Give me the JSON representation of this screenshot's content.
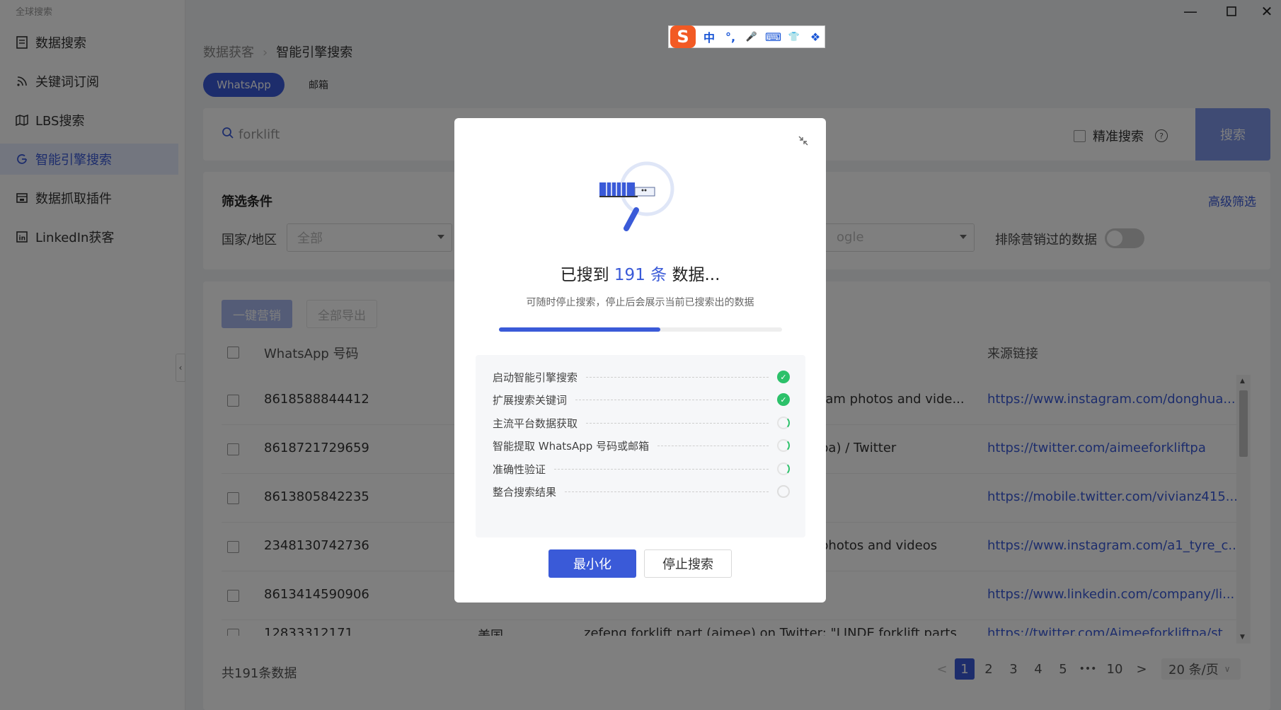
{
  "app_title": "全球搜索",
  "sidebar": {
    "items": [
      {
        "label": "数据搜索",
        "icon": "document-icon",
        "active": false
      },
      {
        "label": "关键词订阅",
        "icon": "rss-icon",
        "active": false
      },
      {
        "label": "LBS搜索",
        "icon": "map-icon",
        "active": false
      },
      {
        "label": "智能引擎搜索",
        "icon": "google-g-icon",
        "active": true
      },
      {
        "label": "数据抓取插件",
        "icon": "plugin-icon",
        "active": false
      },
      {
        "label": "LinkedIn获客",
        "icon": "linkedin-icon",
        "active": false
      }
    ]
  },
  "breadcrumb": {
    "parent": "数据获客",
    "current": "智能引擎搜索"
  },
  "tabs": {
    "active": "WhatsApp",
    "other": "邮箱"
  },
  "search": {
    "value": "forklift",
    "exact_label": "精准搜索",
    "help": "?",
    "button": "搜索"
  },
  "filters": {
    "title": "筛选条件",
    "advanced": "高级筛选",
    "country_label": "国家/地区",
    "country_value": "全部",
    "engine_value": "Google",
    "engine_visible_fragment": "ogle",
    "exclude_label": "排除营销过的数据"
  },
  "table": {
    "actions": {
      "market": "一键营销",
      "export": "全部导出"
    },
    "headers": {
      "phone": "WhatsApp 号码",
      "source": "来源链接"
    },
    "rows": [
      {
        "phone": "8618588844412",
        "country": "",
        "title": "ram photos and vide...",
        "link": "https://www.instagram.com/donghua..."
      },
      {
        "phone": "8618721729659",
        "country": "",
        "title": "pa) / Twitter",
        "link": "https://twitter.com/aimeeforkliftpa"
      },
      {
        "phone": "8613805842235",
        "country": "",
        "title": "",
        "link": "https://mobile.twitter.com/vivianz415..."
      },
      {
        "phone": "2348130742736",
        "country": "",
        "title": "photos and videos",
        "link": "https://www.instagram.com/a1_tyre_c..."
      },
      {
        "phone": "8613414590906",
        "country": "",
        "title": "",
        "link": "https://www.linkedin.com/company/li..."
      },
      {
        "phone": "12833312171",
        "country": "美国",
        "title": "zefeng forklift part (aimee) on Twitter: \"LINDE forklift parts",
        "link": "https://twitter.com/Aimeeforkliftpa/st"
      }
    ],
    "total": "共191条数据",
    "pagination": {
      "prev": "<",
      "pages": [
        "1",
        "2",
        "3",
        "4",
        "5"
      ],
      "ellipsis": "•••",
      "last": "10",
      "next": ">",
      "page_size": "20 条/页",
      "current": 1
    }
  },
  "ime": {
    "logo": "S",
    "items": [
      "中",
      "°,",
      "🎤",
      "⌨",
      "👕",
      "❖"
    ]
  },
  "modal": {
    "headline_prefix": "已搜到 ",
    "count": "191 条",
    "headline_suffix": " 数据...",
    "subtitle": "可随时停止搜索，停止后会展示当前已搜索出的数据",
    "progress": 0.57,
    "steps": [
      {
        "label": "启动智能引擎搜索",
        "status": "done"
      },
      {
        "label": "扩展搜索关键词",
        "status": "done"
      },
      {
        "label": "主流平台数据获取",
        "status": "loading"
      },
      {
        "label": "智能提取 WhatsApp 号码或邮箱",
        "status": "loading"
      },
      {
        "label": "准确性验证",
        "status": "loading"
      },
      {
        "label": "整合搜索结果",
        "status": "pending"
      }
    ],
    "minimize": "最小化",
    "stop": "停止搜索"
  },
  "colors": {
    "accent": "#3a5ad8",
    "success": "#2cc16a"
  }
}
